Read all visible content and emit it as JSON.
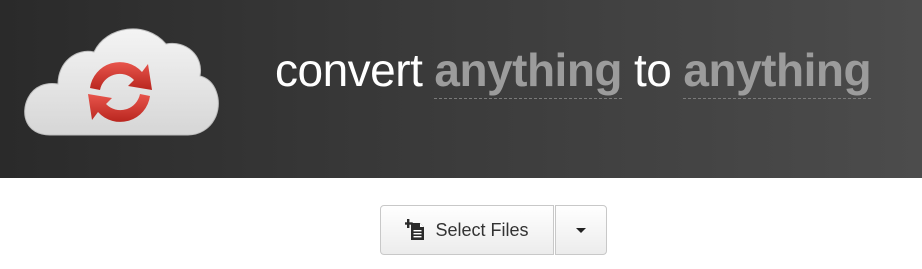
{
  "header": {
    "tagline": {
      "part1": "convert",
      "part2": "anything",
      "part3": "to",
      "part4": "anything"
    },
    "logo_icon": "cloud-refresh-icon",
    "colors": {
      "background_left": "#2a2a2a",
      "background_right": "#4c4c4c",
      "highlight_text": "#9c9c9c",
      "logo_arrows": "#d23a32"
    }
  },
  "controls": {
    "select_files_label": "Select Files",
    "select_files_icon": "add-file-icon",
    "dropdown_icon": "caret-down-icon"
  }
}
